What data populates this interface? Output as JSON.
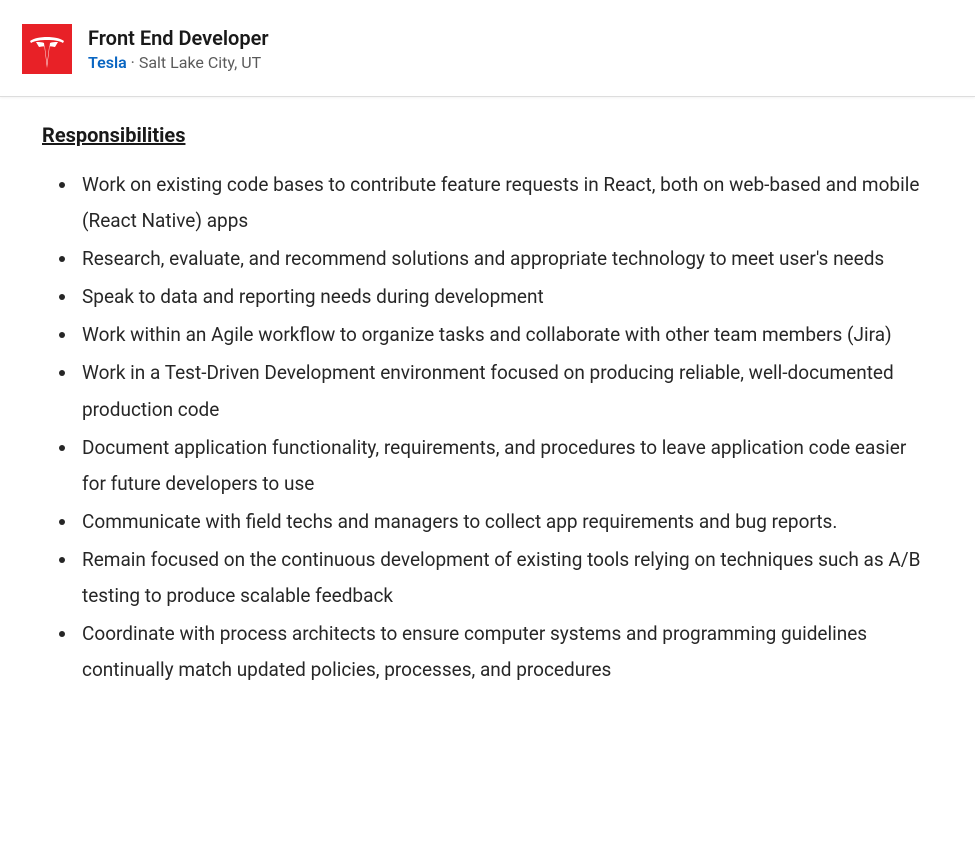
{
  "header": {
    "job_title": "Front End Developer",
    "company": "Tesla",
    "separator": " · ",
    "location": "Salt Lake City, UT",
    "logo_color": "#e82127"
  },
  "section": {
    "heading": "Responsibilities",
    "items": [
      "Work on existing code bases to contribute feature requests in React, both on web-based and mobile (React Native) apps",
      "Research, evaluate, and recommend solutions and appropriate technology to meet user's needs",
      "Speak to data and reporting needs during development",
      "Work within an Agile workflow to organize tasks and collaborate with other team members (Jira)",
      "Work in a Test-Driven Development environment focused on producing reliable, well-documented production code",
      "Document application functionality, requirements, and procedures to leave application code easier for future developers to use",
      "Communicate with field techs and managers to collect app requirements and bug reports.",
      "Remain focused on the continuous development of existing tools relying on techniques such as A/B testing to produce scalable feedback",
      "Coordinate with process architects to ensure computer systems and programming guidelines continually match updated policies, processes, and procedures"
    ]
  }
}
